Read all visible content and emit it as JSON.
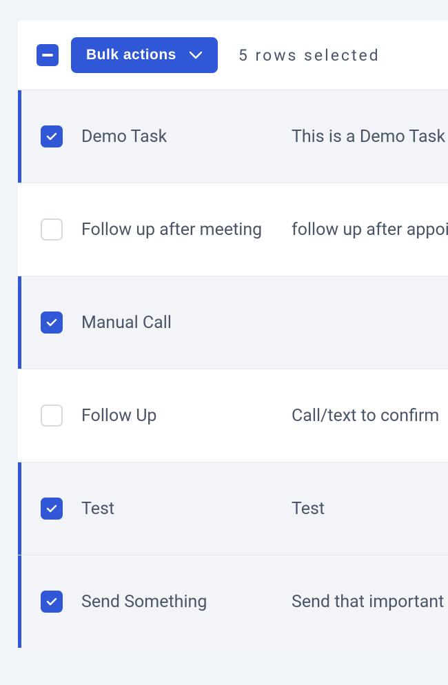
{
  "toolbar": {
    "bulk_actions_label": "Bulk actions",
    "selection_count_text": "5 rows selected"
  },
  "rows": [
    {
      "title": "Demo Task",
      "description": "This is a Demo Task",
      "selected": true
    },
    {
      "title": "Follow up after meeting",
      "description": "follow up after appointment",
      "selected": false
    },
    {
      "title": "Manual Call",
      "description": "",
      "selected": true
    },
    {
      "title": "Follow Up",
      "description": "Call/text to confirm",
      "selected": false
    },
    {
      "title": "Test",
      "description": "Test",
      "selected": true
    },
    {
      "title": "Send Something",
      "description": "Send that important",
      "selected": true
    }
  ]
}
